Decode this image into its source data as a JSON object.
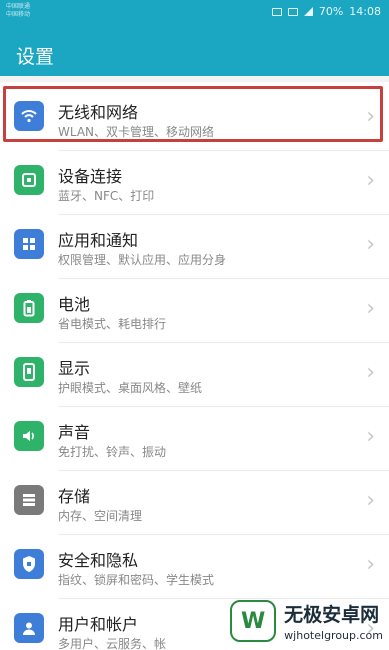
{
  "status": {
    "carrier_line1": "中国联通",
    "carrier_line2": "中国移动",
    "battery": "70%",
    "time": "14:08"
  },
  "header": {
    "title": "设置"
  },
  "settings": [
    {
      "title": "无线和网络",
      "subtitle": "WLAN、双卡管理、移动网络",
      "icon": "wifi-icon",
      "color": "#3f7ed8"
    },
    {
      "title": "设备连接",
      "subtitle": "蓝牙、NFC、打印",
      "icon": "device-connect-icon",
      "color": "#2fb36a"
    },
    {
      "title": "应用和通知",
      "subtitle": "权限管理、默认应用、应用分身",
      "icon": "apps-icon",
      "color": "#3f7ed8"
    },
    {
      "title": "电池",
      "subtitle": "省电模式、耗电排行",
      "icon": "battery-icon",
      "color": "#2fb36a"
    },
    {
      "title": "显示",
      "subtitle": "护眼模式、桌面风格、壁纸",
      "icon": "display-icon",
      "color": "#2fb36a"
    },
    {
      "title": "声音",
      "subtitle": "免打扰、铃声、振动",
      "icon": "sound-icon",
      "color": "#2fb36a"
    },
    {
      "title": "存储",
      "subtitle": "内存、空间清理",
      "icon": "storage-icon",
      "color": "#7a7a7a"
    },
    {
      "title": "安全和隐私",
      "subtitle": "指纹、锁屏和密码、学生模式",
      "icon": "shield-icon",
      "color": "#3f7ed8"
    },
    {
      "title": "用户和帐户",
      "subtitle": "多用户、云服务、帐",
      "icon": "user-icon",
      "color": "#3f7ed8"
    }
  ],
  "watermark": {
    "title": "无极安卓网",
    "url": "wjhotelgroup.com",
    "logo_icon": "w-logo-icon"
  }
}
